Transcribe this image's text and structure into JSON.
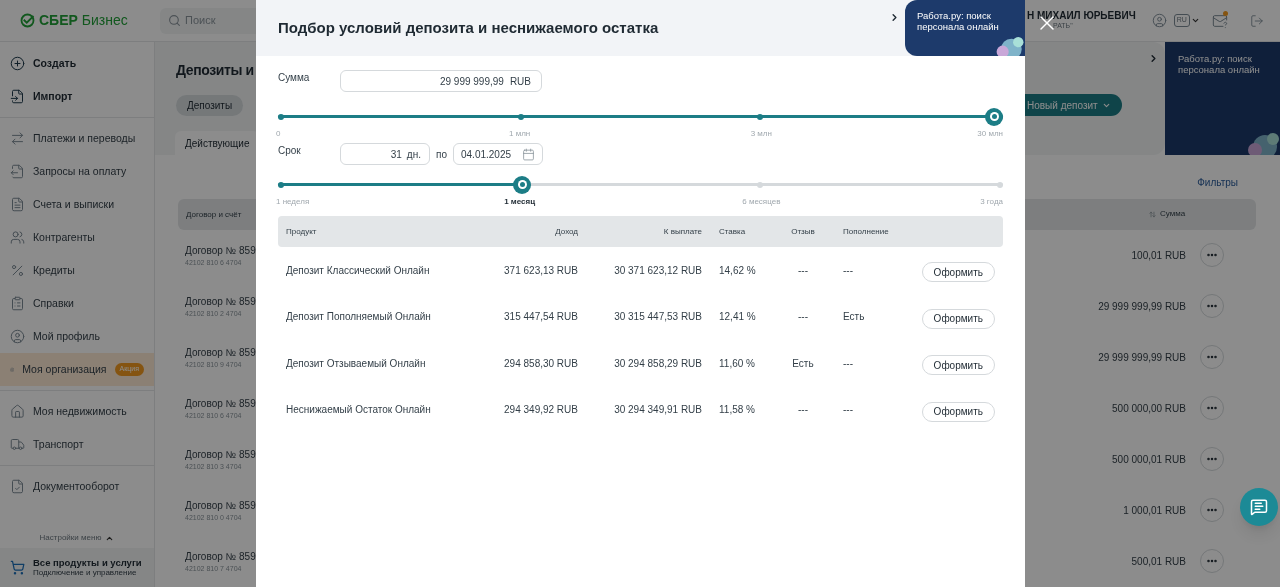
{
  "header": {
    "logo_brand": "СБЕР",
    "logo_product": "Бизнес",
    "search_placeholder": "Поиск",
    "user_name": "Н МИХАИЛ ЮРЬЕВИЧ",
    "user_org": "РАТЬ\"",
    "language": "RU"
  },
  "sidebar": {
    "groups": [
      {
        "items": [
          {
            "label": "Создать",
            "kind": "action",
            "selected": false
          },
          {
            "label": "Импорт",
            "kind": "action",
            "selected": false
          }
        ]
      },
      {
        "items": [
          {
            "label": "Платежи и переводы",
            "kind": "nav",
            "selected": false
          },
          {
            "label": "Запросы на оплату",
            "kind": "nav",
            "selected": false
          },
          {
            "label": "Счета и выписки",
            "kind": "nav",
            "selected": false
          },
          {
            "label": "Контрагенты",
            "kind": "nav",
            "selected": false
          },
          {
            "label": "Кредиты",
            "kind": "nav",
            "selected": false
          },
          {
            "label": "Справки",
            "kind": "nav",
            "selected": false
          },
          {
            "label": "Мой профиль",
            "kind": "nav",
            "selected": false
          },
          {
            "label": "Моя организация",
            "kind": "nav",
            "selected": true,
            "badge": "Акция"
          }
        ]
      },
      {
        "items": [
          {
            "label": "Моя недвижимость",
            "kind": "nav",
            "selected": false
          },
          {
            "label": "Транспорт",
            "kind": "nav",
            "selected": false
          }
        ]
      },
      {
        "items": [
          {
            "label": "Документооборот",
            "kind": "nav",
            "selected": false
          }
        ]
      }
    ],
    "menu_settings": "Настройки меню",
    "all_products": {
      "title": "Все продукты и услуги",
      "subtitle": "Подключение и управление"
    }
  },
  "page": {
    "title": "Депозиты и",
    "chips": [
      {
        "label": "Депозиты",
        "selected": true
      }
    ],
    "tabs": [
      {
        "label": "Действующие",
        "selected": true
      }
    ],
    "new_deposit": "Новый депозит",
    "promo": "Работа.ру: поиск персонала онлайн",
    "filters": "Фильтры",
    "table": {
      "columns": [
        "Договор и счёт",
        "Сумма"
      ],
      "rows": [
        {
          "contract": "Договор № 859",
          "account": "42102 810 6 4704",
          "amount": "100,01 RUB"
        },
        {
          "contract": "Договор № 859",
          "account": "42102 810 2 4704",
          "amount": "29 999 999,99 RUB"
        },
        {
          "contract": "Договор № 859",
          "account": "42102 810 9 4704",
          "amount": "29 999 999,99 RUB"
        },
        {
          "contract": "Договор № 859",
          "account": "42102 810 6 4704",
          "amount": "500 000,00 RUB"
        },
        {
          "contract": "Договор № 859",
          "account": "42102 810 3 4704",
          "amount": "500 000,01 RUB"
        },
        {
          "contract": "Договор № 859",
          "account": "42102 810 0 4704",
          "amount": "1 000,01 RUB"
        },
        {
          "contract": "Договор № 859",
          "account": "42102 810 7 4704",
          "amount": "500,01 RUB"
        }
      ]
    }
  },
  "modal": {
    "title": "Подбор условий депозита и неснижаемого остатка",
    "promo": "Работа.ру: поиск персонала онлайн",
    "amount": {
      "label": "Сумма",
      "value": "29 999 999,99",
      "unit": "RUB",
      "level": 1,
      "ticks": [
        {
          "label": "0",
          "selected": false
        },
        {
          "label": "1 млн",
          "selected": false
        },
        {
          "label": "3 млн",
          "selected": false
        },
        {
          "label": "30 млн",
          "selected": false
        }
      ]
    },
    "term": {
      "label": "Срок",
      "days": "31",
      "unit": "дн.",
      "to_label": "по",
      "date": "04.01.2025",
      "level": 0.333,
      "ticks": [
        {
          "label": "1 неделя",
          "selected": false
        },
        {
          "label": "1 месяц",
          "selected": true
        },
        {
          "label": "6 месяцев",
          "selected": false
        },
        {
          "label": "3 года",
          "selected": false
        }
      ]
    },
    "table": {
      "columns": [
        "Продукт",
        "Доход",
        "К выплате",
        "Ставка",
        "Отзыв",
        "Пополнение"
      ],
      "rows": [
        {
          "product": "Депозит Классический Онлайн",
          "income": "371 623,13 RUB",
          "payout": "30 371 623,12 RUB",
          "rate": "14,62 %",
          "withdrawal": "---",
          "topup": "---",
          "action": "Оформить"
        },
        {
          "product": "Депозит Пополняемый Онлайн",
          "income": "315 447,54 RUB",
          "payout": "30 315 447,53 RUB",
          "rate": "12,41 %",
          "withdrawal": "---",
          "topup": "Есть",
          "action": "Оформить"
        },
        {
          "product": "Депозит Отзываемый Онлайн",
          "income": "294 858,30 RUB",
          "payout": "30 294 858,29 RUB",
          "rate": "11,60 %",
          "withdrawal": "Есть",
          "topup": "---",
          "action": "Оформить"
        },
        {
          "product": "Неснижаемый Остаток Онлайн",
          "income": "294 349,92 RUB",
          "payout": "30 294 349,91 RUB",
          "rate": "11,58 %",
          "withdrawal": "---",
          "topup": "---",
          "action": "Оформить"
        }
      ]
    }
  }
}
